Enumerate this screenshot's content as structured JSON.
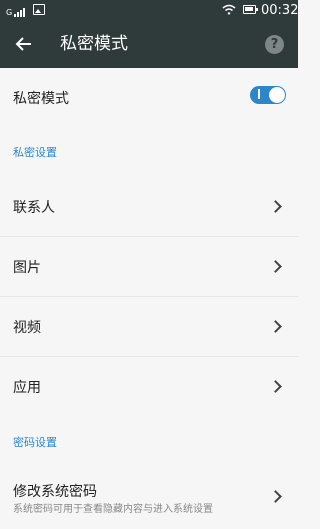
{
  "status_bar": {
    "signal_label": "G",
    "signal_icon": "signal-icon",
    "image_icon": "image-notification-icon",
    "wifi_icon": "wifi-icon",
    "battery_icon": "battery-icon",
    "time": "00:32"
  },
  "header": {
    "back_icon": "arrow-left-icon",
    "title": "私密模式",
    "help_icon": "help-icon",
    "help_glyph": "?"
  },
  "private_mode": {
    "label": "私密模式",
    "enabled": true
  },
  "sections": {
    "private_settings": "私密设置",
    "password_settings": "密码设置"
  },
  "items": [
    {
      "label": "联系人"
    },
    {
      "label": "图片"
    },
    {
      "label": "视频"
    },
    {
      "label": "应用"
    }
  ],
  "change_password": {
    "label": "修改系统密码",
    "description": "系统密码可用于查看隐藏内容与进入系统设置"
  },
  "colors": {
    "toolbar": "#2f3a3a",
    "accent": "#2d86c8",
    "background": "#f6f6f6"
  }
}
